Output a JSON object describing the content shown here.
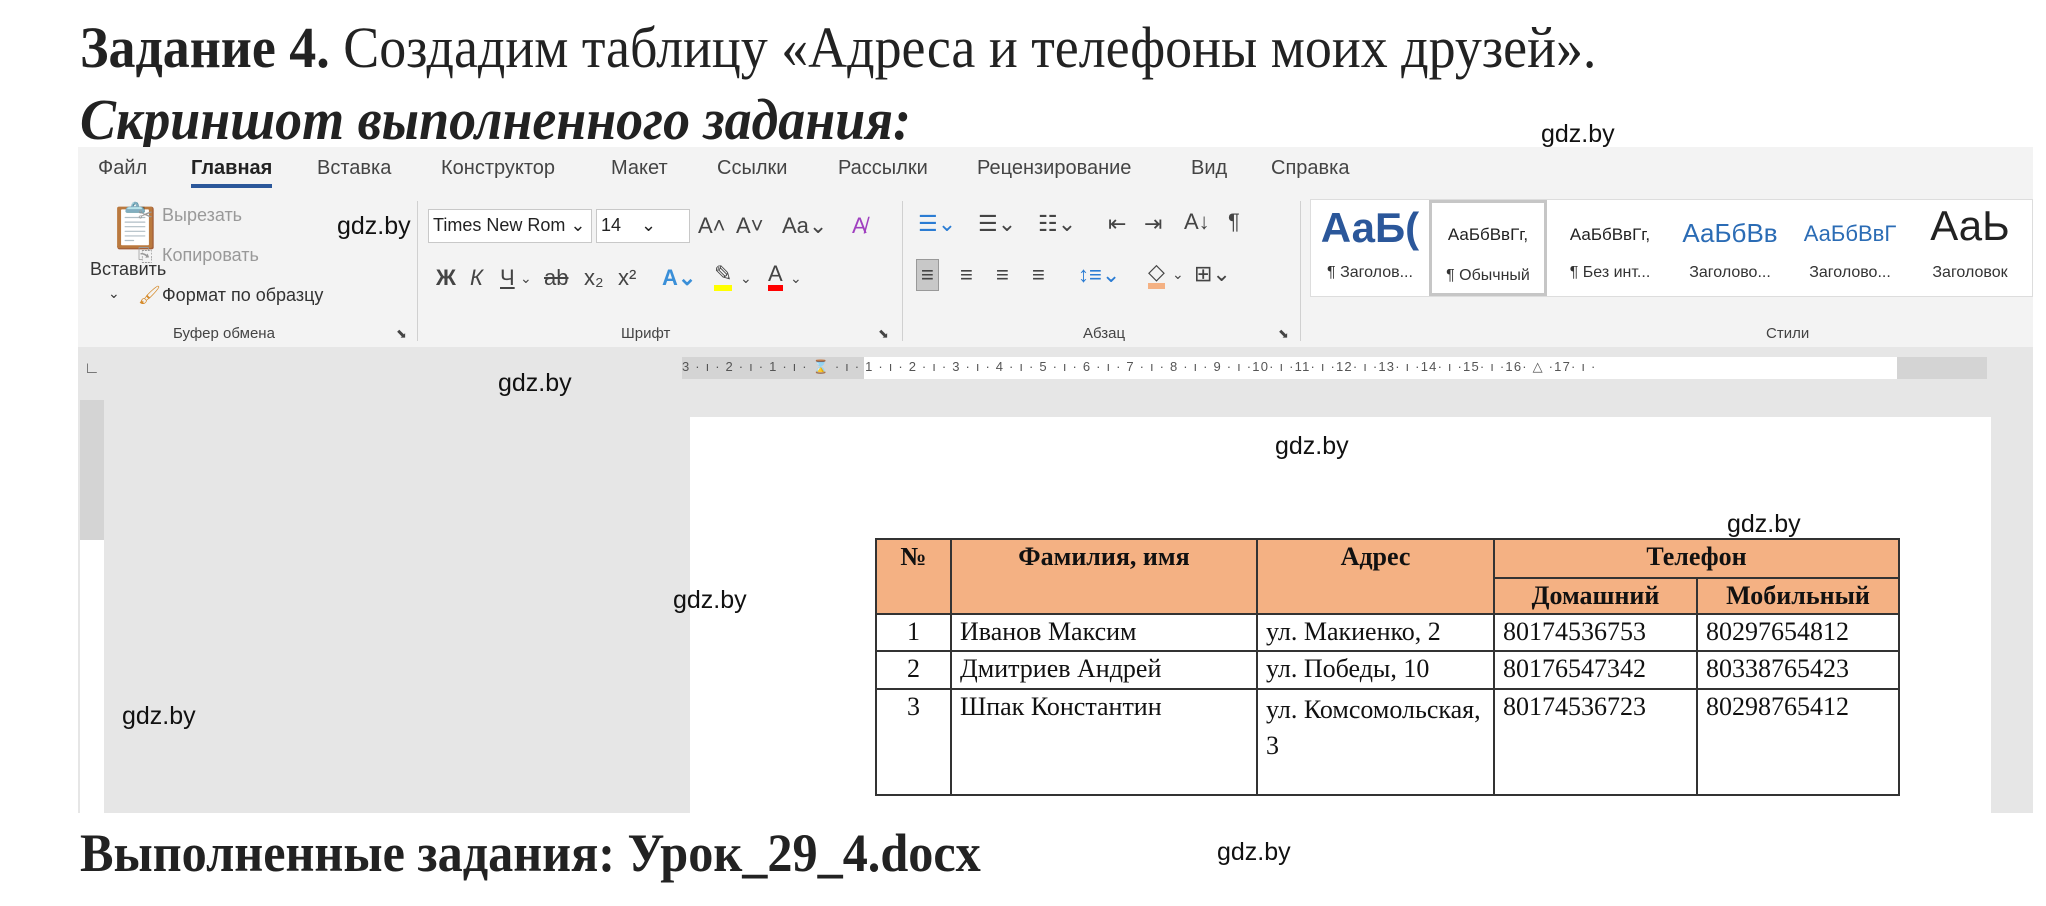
{
  "heading": {
    "task_bold": "Задание 4.",
    "task_text": " Создадим таблицу «Адреса и телефоны моих друзей».",
    "subtitle": "Скриншот выполненного задания:"
  },
  "footer": "Выполненные задания: Урок_29_4.docx",
  "watermark": "gdz.by",
  "ribbon": {
    "tabs": [
      "Файл",
      "Главная",
      "Вставка",
      "Конструктор",
      "Макет",
      "Ссылки",
      "Рассылки",
      "Рецензирование",
      "Вид",
      "Справка"
    ],
    "active_tab": "Главная",
    "clipboard": {
      "paste": "Вставить",
      "cut": "Вырезать",
      "copy": "Копировать",
      "format_painter": "Формат по образцу",
      "label": "Буфер обмена"
    },
    "font": {
      "name": "Times New Rom",
      "size": "14",
      "change_case": "Aa",
      "bold": "Ж",
      "italic": "К",
      "underline": "Ч",
      "label": "Шрифт"
    },
    "paragraph": {
      "label": "Абзац"
    },
    "styles": {
      "label": "Стили",
      "items": [
        {
          "preview": "АаБ(",
          "name": "¶ Заголов..."
        },
        {
          "preview": "АаБбВвГг,",
          "name": "¶ Обычный",
          "selected": true
        },
        {
          "preview": "АаБбВвГг,",
          "name": "¶ Без инт..."
        },
        {
          "preview": "АаБбВв",
          "name": "Заголово..."
        },
        {
          "preview": "АаБбВвГ",
          "name": "Заголово..."
        },
        {
          "preview": "АаЬ",
          "name": "Заголовок"
        }
      ]
    },
    "colors": {
      "accent": "#2b579a",
      "highlight": "#ffff00",
      "font_color": "#ff0000",
      "shading": "#f4b183"
    }
  },
  "ruler": {
    "marks": "3 · ı · 2 · ı · 1 · ı · ⌛ · ı · 1 · ı · 2 · ı · 3 · ı · 4 · ı · 5 · ı · 6 · ı · 7 · ı · 8 · ı · 9 · ı ·10· ı ·11· ı ·12· ı ·13· ı ·14· ı ·15· ı ·16· △ ·17· ı ·"
  },
  "table": {
    "header_color": "#f4b183",
    "headers": {
      "num": "№",
      "name": "Фамилия, имя",
      "address": "Адрес",
      "phone": "Телефон",
      "home": "Домашний",
      "mobile": "Мобильный"
    },
    "rows": [
      {
        "num": "1",
        "name": "Иванов Максим",
        "address": "ул. Макиенко, 2",
        "home": "80174536753",
        "mobile": "80297654812"
      },
      {
        "num": "2",
        "name": "Дмитриев Андрей",
        "address": "ул. Победы, 10",
        "home": "80176547342",
        "mobile": "80338765423"
      },
      {
        "num": "3",
        "name": "Шпак Константин",
        "address": "ул. Комсомольская, 3",
        "home": "80174536723",
        "mobile": "80298765412"
      }
    ]
  }
}
